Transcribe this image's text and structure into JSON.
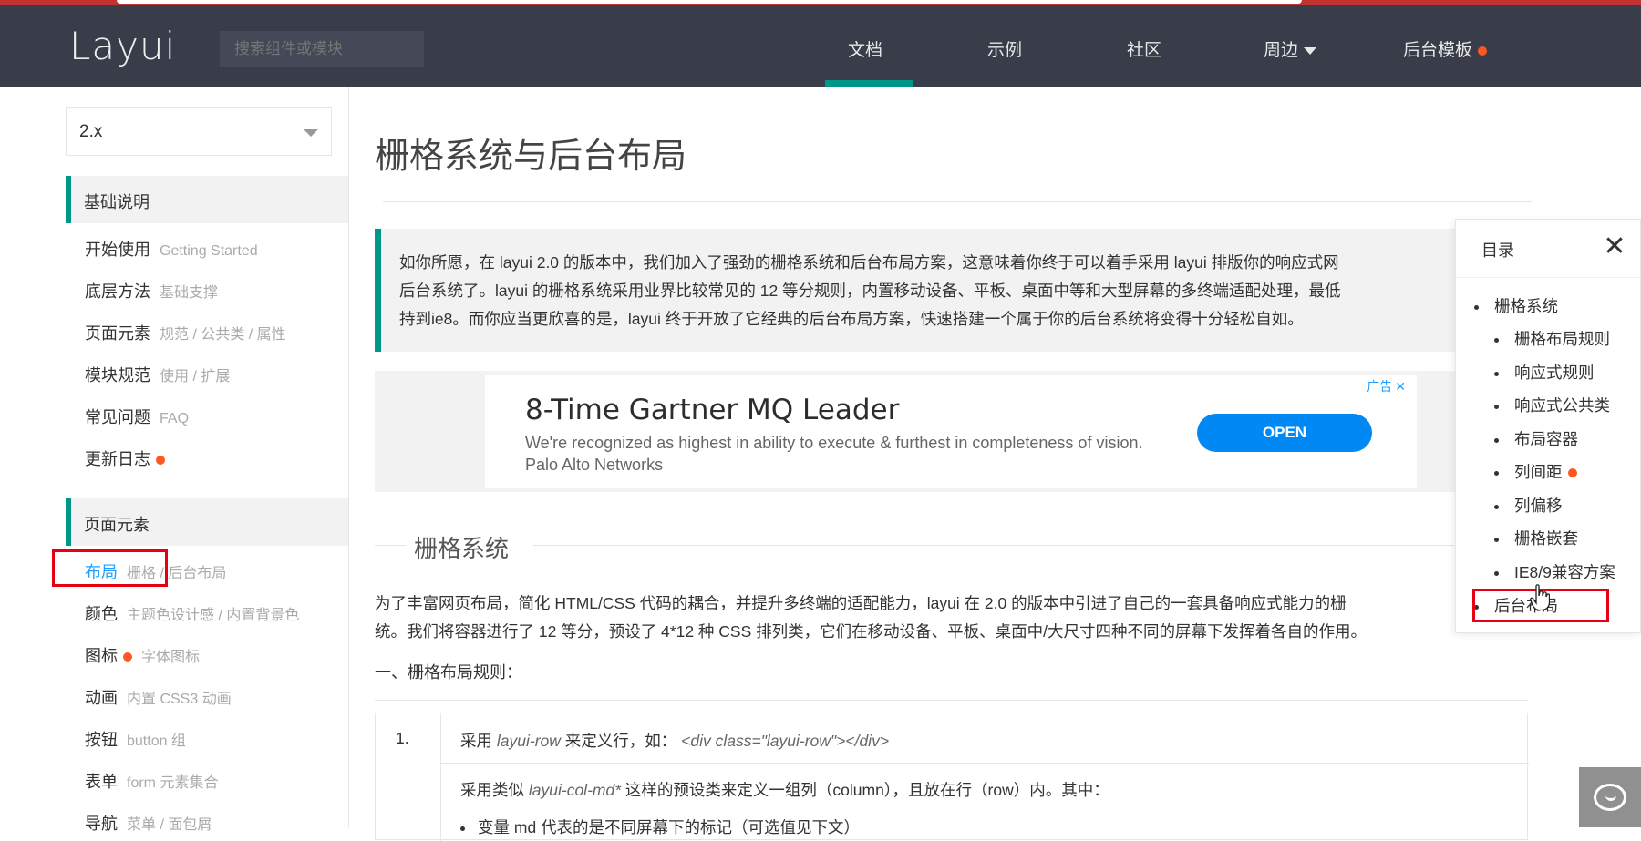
{
  "header": {
    "logo": "Layui",
    "search_placeholder": "搜索组件或模块",
    "nav": [
      {
        "label": "文档"
      },
      {
        "label": "示例"
      },
      {
        "label": "社区"
      },
      {
        "label": "周边"
      },
      {
        "label": "后台模板"
      }
    ]
  },
  "sidebar": {
    "version": "2.x",
    "section1": "基础说明",
    "items1": [
      {
        "label": "开始使用",
        "sub": "Getting Started"
      },
      {
        "label": "底层方法",
        "sub": "基础支撑"
      },
      {
        "label": "页面元素",
        "sub": "规范 / 公共类 / 属性"
      },
      {
        "label": "模块规范",
        "sub": "使用 / 扩展"
      },
      {
        "label": "常见问题",
        "sub": "FAQ"
      },
      {
        "label": "更新日志",
        "sub": ""
      }
    ],
    "section2": "页面元素",
    "items2": [
      {
        "label": "布局",
        "sub": "栅格 / 后台布局"
      },
      {
        "label": "颜色",
        "sub": "主题色设计感 / 内置背景色"
      },
      {
        "label": "图标",
        "sub": "字体图标"
      },
      {
        "label": "动画",
        "sub": "内置 CSS3 动画"
      },
      {
        "label": "按钮",
        "sub": "button 组"
      },
      {
        "label": "表单",
        "sub": "form 元素集合"
      },
      {
        "label": "导航",
        "sub": "菜单 / 面包屑"
      }
    ]
  },
  "main": {
    "title": "栅格系统与后台布局",
    "intro": [
      "如你所愿，在 layui 2.0 的版本中，我们加入了强劲的栅格系统和后台布局方案，这意味着你终于可以着手采用 layui 排版你的响应式网",
      "后台系统了。layui 的栅格系统采用业界比较常见的 12 等分规则，内置移动设备、平板、桌面中等和大型屏幕的多终端适配处理，最低",
      "持到ie8。而你应当更欣喜的是，layui 终于开放了它经典的后台布局方案，快速搭建一个属于你的后台系统将变得十分轻松自如。"
    ],
    "ad": {
      "label": "广告",
      "close": "✕",
      "title": "8-Time Gartner MQ Leader",
      "desc": "We're recognized as highest in ability to execute & furthest in completeness of vision. Palo Alto Networks",
      "button": "OPEN"
    },
    "section_title": "栅格系统",
    "para": [
      "为了丰富网页布局，简化 HTML/CSS 代码的耦合，并提升多终端的适配能力，layui 在 2.0 的版本中引进了自己的一套具备响应式能力的栅",
      "统。我们将容器进行了 12 等分，预设了 4*12 种 CSS 排列类，它们在移动设备、平板、桌面中/大尺寸四种不同的屏幕下发挥着各自的作用。"
    ],
    "rule_title": "一、栅格布局规则：",
    "table": {
      "num1": "1.",
      "row1_a": "采用",
      "row1_code1": "layui-row",
      "row1_b": "来定义行，如：",
      "row1_code2": "<div class=\"layui-row\"></div>",
      "row2_a": "采用类似",
      "row2_code": "layui-col-md*",
      "row2_b": "这样的预设类来定义一组列（column），且放在行（row）内。其中：",
      "row3": "变量 md 代表的是不同屏幕下的标记（可选值见下文）"
    }
  },
  "toc": {
    "title": "目录",
    "close": "✕",
    "items": [
      {
        "label": "栅格系统",
        "level": 1
      },
      {
        "label": "栅格布局规则",
        "level": 2
      },
      {
        "label": "响应式规则",
        "level": 2
      },
      {
        "label": "响应式公共类",
        "level": 2
      },
      {
        "label": "布局容器",
        "level": 2
      },
      {
        "label": "列间距",
        "level": 2
      },
      {
        "label": "列偏移",
        "level": 2
      },
      {
        "label": "栅格嵌套",
        "level": 2
      },
      {
        "label": "IE8/9兼容方案",
        "level": 2
      },
      {
        "label": "后台布局",
        "level": 1
      }
    ]
  },
  "colors": {
    "header_bg": "#393d49",
    "accent": "#009688",
    "badge": "#ff5722",
    "link": "#1e9fff",
    "highlight_box": "#e60012"
  },
  "icons": {
    "toc_close": "close-icon",
    "version_caret": "chevron-down-icon",
    "chat": "chat-bubble-icon",
    "cursor": "hand-pointer-icon"
  }
}
